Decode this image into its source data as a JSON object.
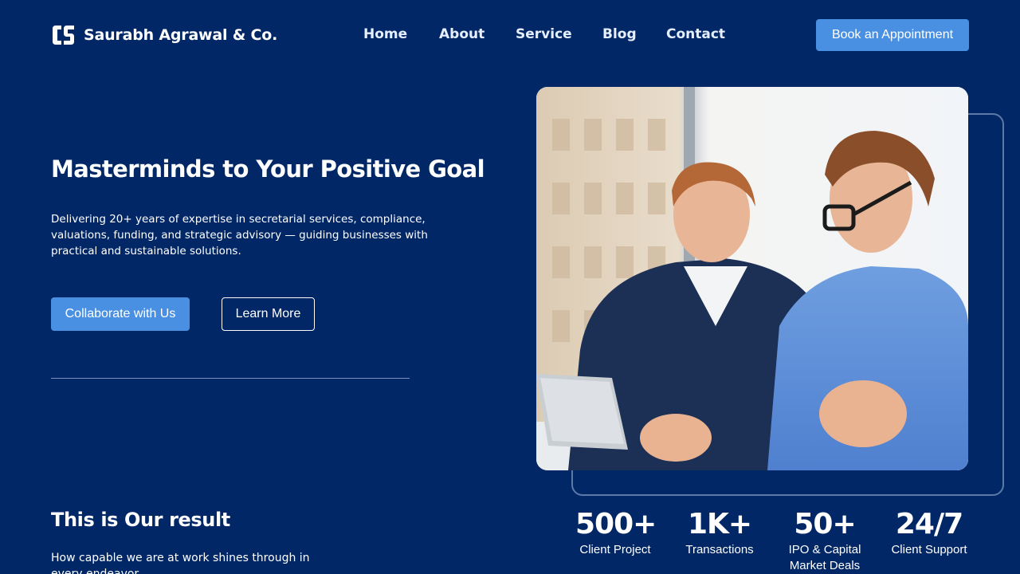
{
  "brand": {
    "name": "Saurabh Agrawal & Co.",
    "logo_letters": "CS"
  },
  "nav": {
    "items": [
      "Home",
      "About",
      "Service",
      "Blog",
      "Contact"
    ]
  },
  "header": {
    "cta_label": "Book an Appointment"
  },
  "hero": {
    "title": "Masterminds to Your Positive Goal",
    "description": "Delivering 20+ years of expertise in secretarial services, compliance, valuations, funding, and strategic advisory — guiding businesses with practical and sustainable solutions.",
    "primary_button": "Collaborate with Us",
    "secondary_button": "Learn More",
    "image_alt": "Two businessmen reviewing a tablet"
  },
  "results": {
    "title": "This is Our result",
    "description": "How capable we are at work shines through in every endeavor"
  },
  "stats": [
    {
      "value": "500+",
      "label": "Client Project"
    },
    {
      "value": "1K+",
      "label": "Transactions"
    },
    {
      "value": "50+",
      "label": "IPO & Capital Market Deals"
    },
    {
      "value": "24/7",
      "label": "Client Support"
    }
  ],
  "colors": {
    "background": "#012766",
    "accent": "#4a90e2",
    "text": "#ffffff"
  }
}
